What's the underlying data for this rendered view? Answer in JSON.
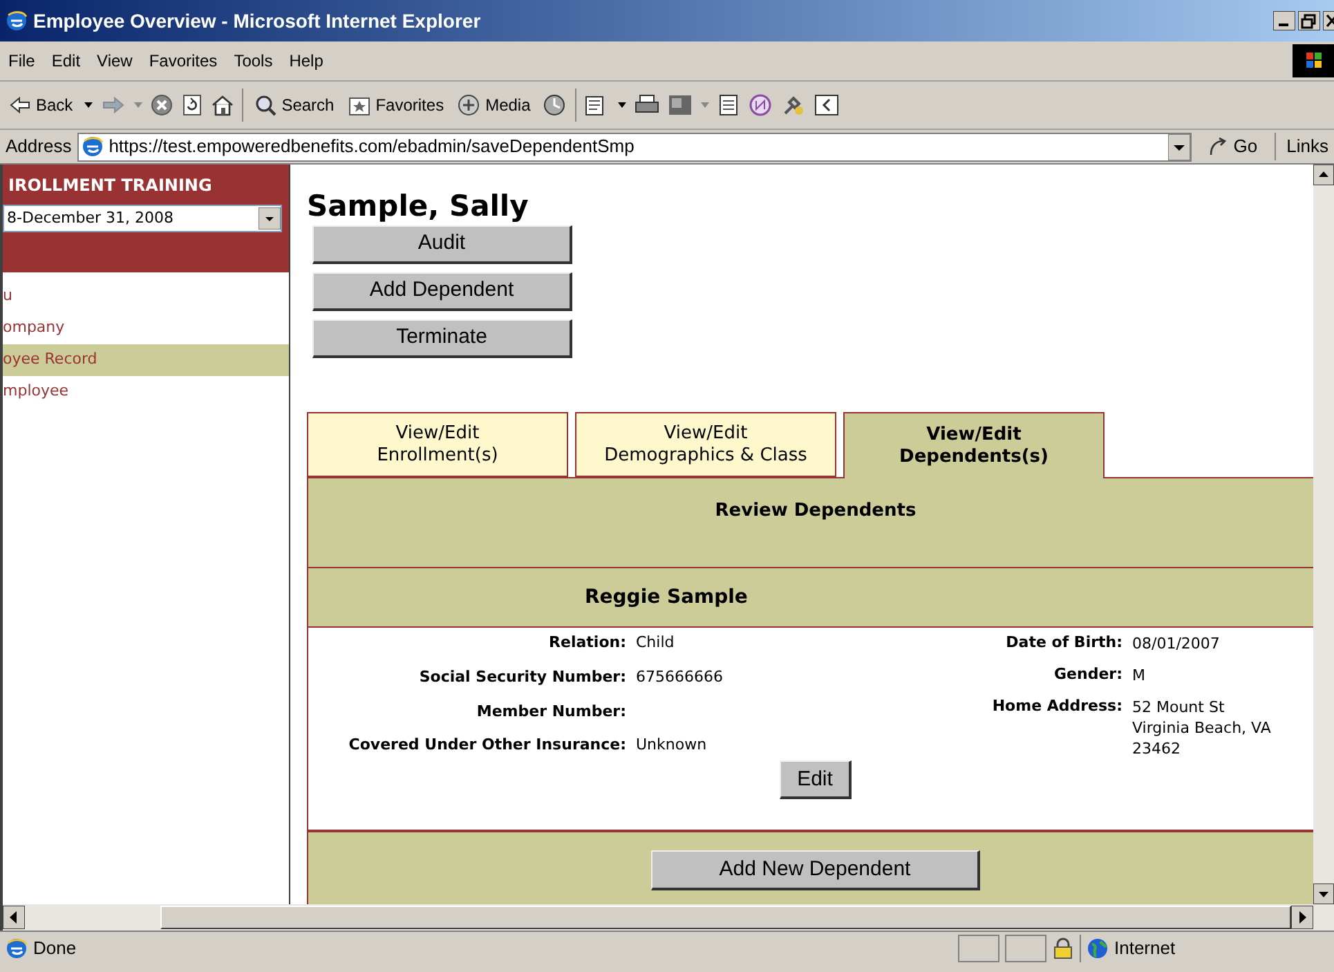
{
  "window": {
    "title": "Employee Overview - Microsoft Internet Explorer"
  },
  "menu": [
    "File",
    "Edit",
    "View",
    "Favorites",
    "Tools",
    "Help"
  ],
  "toolbar": {
    "back": "Back",
    "search": "Search",
    "favorites": "Favorites",
    "media": "Media"
  },
  "address": {
    "label": "Address",
    "url": "https://test.empoweredbenefits.com/ebadmin/saveDependentSmp",
    "go": "Go",
    "links": "Links"
  },
  "sidebar": {
    "title": "IROLLMENT TRAINING",
    "plan_year": "8-December 31, 2008",
    "items": [
      {
        "label": "u",
        "selected": false
      },
      {
        "label": "ompany",
        "selected": false
      },
      {
        "label": "oyee Record",
        "selected": true
      },
      {
        "label": "mployee",
        "selected": false
      }
    ]
  },
  "employee": {
    "name": "Sample, Sally",
    "buttons": [
      "Audit",
      "Add Dependent",
      "Terminate"
    ]
  },
  "tabs": [
    {
      "lines": [
        "View/Edit",
        "Enrollment(s)"
      ],
      "selected": false
    },
    {
      "lines": [
        "View/Edit",
        "Demographics & Class"
      ],
      "selected": false
    },
    {
      "lines": [
        "View/Edit",
        "Dependents(s)"
      ],
      "selected": true
    }
  ],
  "panel": {
    "heading": "Review Dependents",
    "dependent_name": "Reggie Sample",
    "left_fields": [
      {
        "label": "Relation:",
        "value": "Child"
      },
      {
        "label": "Social Security Number:",
        "value": "675666666"
      },
      {
        "label": "Member Number:"
      },
      {
        "label": "Covered Under Other Insurance:",
        "value": "Unknown"
      }
    ],
    "right_fields": [
      {
        "label": "Date of Birth:",
        "lines": [
          "08/01/2007"
        ]
      },
      {
        "label": "Gender:",
        "lines": [
          "M"
        ]
      },
      {
        "label": "Home Address:",
        "lines": [
          "52 Mount St",
          "Virginia Beach, VA",
          "23462"
        ]
      }
    ],
    "edit_button": "Edit",
    "add_button": "Add New Dependent"
  },
  "status_bar": {
    "text": "Done",
    "zone": "Internet"
  }
}
